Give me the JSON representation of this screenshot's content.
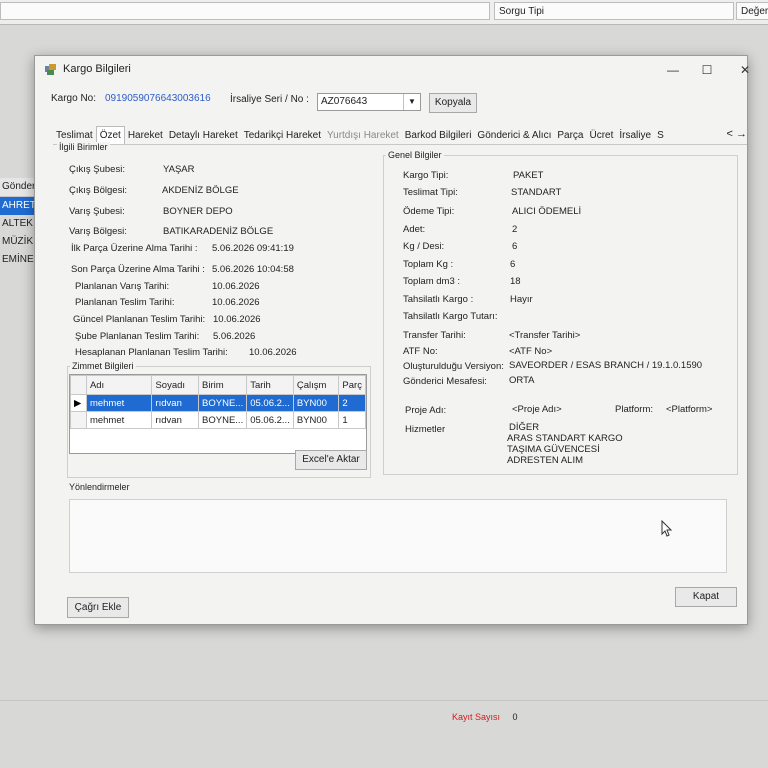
{
  "background": {
    "sorgu_tipi_label": "Sorgu Tipi",
    "deger_label": "Değer",
    "left_rows": [
      "Gönderici",
      "AHRETT",
      "ALTEK YA",
      "MÜZİK AL",
      "EMİNE A"
    ],
    "kayit_sayisi_label": "Kayıt Sayısı",
    "kayit_sayisi_value": "0"
  },
  "window": {
    "title": "Kargo Bilgileri",
    "minimize": "—",
    "maximize": "☐",
    "close": "✕"
  },
  "header": {
    "kargo_no_label": "Kargo No:",
    "kargo_no_value": "0919059076643003616",
    "irsaliye_label": "İrsaliye Seri / No :",
    "irsaliye_value": "AZ076643",
    "kopyala_label": "Kopyala"
  },
  "tabs": [
    {
      "label": "Teslimat"
    },
    {
      "label": "Özet"
    },
    {
      "label": "Hareket"
    },
    {
      "label": "Detaylı Hareket"
    },
    {
      "label": "Tedarikçi Hareket"
    },
    {
      "label": "Yurtdışı Hareket"
    },
    {
      "label": "Barkod Bilgileri"
    },
    {
      "label": "Gönderici & Alıcı"
    },
    {
      "label": "Parça"
    },
    {
      "label": "Ücret"
    },
    {
      "label": "İrsaliye"
    },
    {
      "label": "S"
    }
  ],
  "ilgili_birimler": {
    "title": "İlgili Birimler",
    "rows": [
      {
        "label": "Çıkış Şubesi:",
        "value": "YAŞAR"
      },
      {
        "label": "Çıkış Bölgesi:",
        "value": "AKDENİZ BÖLGE"
      },
      {
        "label": "Varış Şubesi:",
        "value": "BOYNER DEPO"
      },
      {
        "label": "Varış Bölgesi:",
        "value": "BATIKARADENİZ BÖLGE"
      }
    ],
    "dates": [
      {
        "label": "İlk Parça Üzerine Alma Tarihi :",
        "value": "5.06.2026 09:41:19"
      },
      {
        "label": "Son Parça Üzerine Alma Tarihi :",
        "value": "5.06.2026 10:04:58"
      },
      {
        "label": "Planlanan Varış Tarihi:",
        "value": "10.06.2026"
      },
      {
        "label": "Planlanan Teslim Tarihi:",
        "value": "10.06.2026"
      },
      {
        "label": "Güncel Planlanan Teslim Tarihi:",
        "value": "10.06.2026"
      },
      {
        "label": "Şube Planlanan Teslim Tarihi:",
        "value": "5.06.2026"
      },
      {
        "label": "Hesaplanan Planlanan Teslim Tarihi:",
        "value": "10.06.2026"
      }
    ]
  },
  "zimmet": {
    "title": "Zimmet Bilgileri",
    "columns": [
      "Adı",
      "Soyadı",
      "Birim",
      "Tarih",
      "Çalışm",
      "Parç"
    ],
    "rows": [
      [
        "mehmet",
        "rıdvan",
        "BOYNE...",
        "05.06.2...",
        "BYN00",
        "2"
      ],
      [
        "mehmet",
        "rıdvan",
        "BOYNE...",
        "05.06.2...",
        "BYN00",
        "1"
      ]
    ],
    "excel_button": "Excel'e Aktar"
  },
  "genel_bilgiler": {
    "title": "Genel Bilgiler",
    "rows": [
      {
        "label": "Kargo Tipi:",
        "value": "PAKET"
      },
      {
        "label": "Teslimat Tipi:",
        "value": "STANDART"
      },
      {
        "label": "Ödeme Tipi:",
        "value": "ALICI ÖDEMELİ"
      },
      {
        "label": "Adet:",
        "value": "2"
      },
      {
        "label": "Kg / Desi:",
        "value": "6"
      },
      {
        "label": "Toplam Kg :",
        "value": "6"
      },
      {
        "label": "Toplam dm3 :",
        "value": "18"
      },
      {
        "label": "Tahsilatlı Kargo :",
        "value": "Hayır"
      },
      {
        "label": "Tahsilatlı Kargo Tutarı:",
        "value": ""
      },
      {
        "label": "Transfer Tarihi:",
        "value": "<Transfer Tarihi>"
      },
      {
        "label": "ATF No:",
        "value": "<ATF No>"
      },
      {
        "label": "Oluşturulduğu Versiyon:",
        "value": "SAVEORDER / ESAS BRANCH / 19.1.0.1590"
      },
      {
        "label": "Gönderici Mesafesi:",
        "value": "ORTA"
      }
    ],
    "proje_label": "Proje Adı:",
    "proje_value": "<Proje Adı>",
    "platform_label": "Platform:",
    "platform_value": "<Platform>",
    "hizmetler_label": "Hizmetler",
    "hizmetler": [
      "DİĞER",
      "ARAS STANDART KARGO",
      "TAŞIMA GÜVENCESİ",
      "ADRESTEN ALIM"
    ]
  },
  "yonlendirmeler": {
    "title": "Yönlendirmeler"
  },
  "footer": {
    "cagri_ekle": "Çağrı Ekle",
    "kapat": "Kapat"
  }
}
